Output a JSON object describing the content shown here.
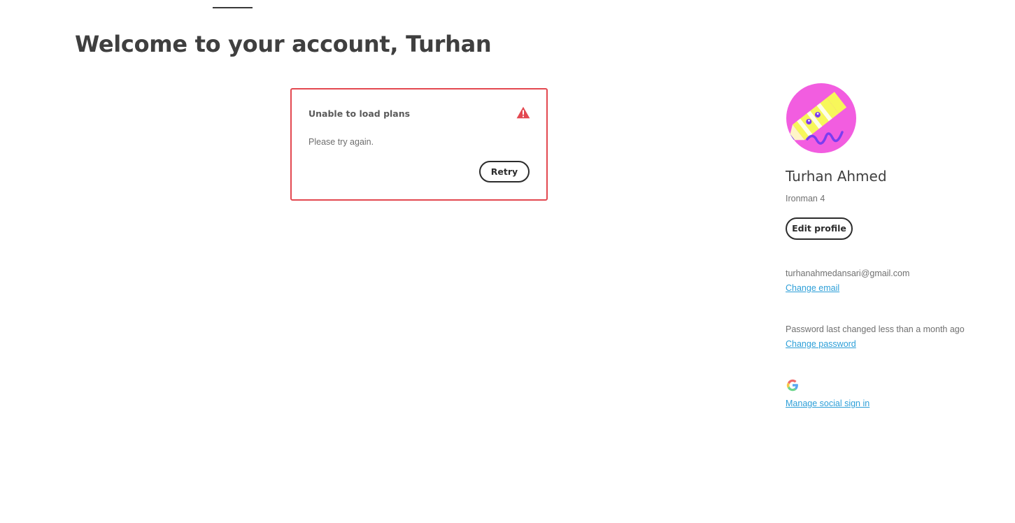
{
  "header": {
    "title": "Welcome to your account, Turhan"
  },
  "plans_error": {
    "title": "Unable to load plans",
    "message": "Please try again.",
    "retry_label": "Retry",
    "icon": "alert-triangle-icon",
    "accent_color": "#e34850"
  },
  "profile": {
    "avatar_icon": "pencil-avatar",
    "name": "Turhan Ahmed",
    "subtitle": "Ironman 4",
    "edit_label": "Edit profile",
    "email": "turhanahmedansari@gmail.com",
    "change_email_label": "Change email",
    "password_status": "Password last changed less than a month ago",
    "change_password_label": "Change password",
    "social_icon": "google-icon",
    "manage_social_label": "Manage social sign in"
  },
  "colors": {
    "link": "#2d9fd8",
    "error_border": "#e34850",
    "avatar_bg": "#f25de0"
  }
}
